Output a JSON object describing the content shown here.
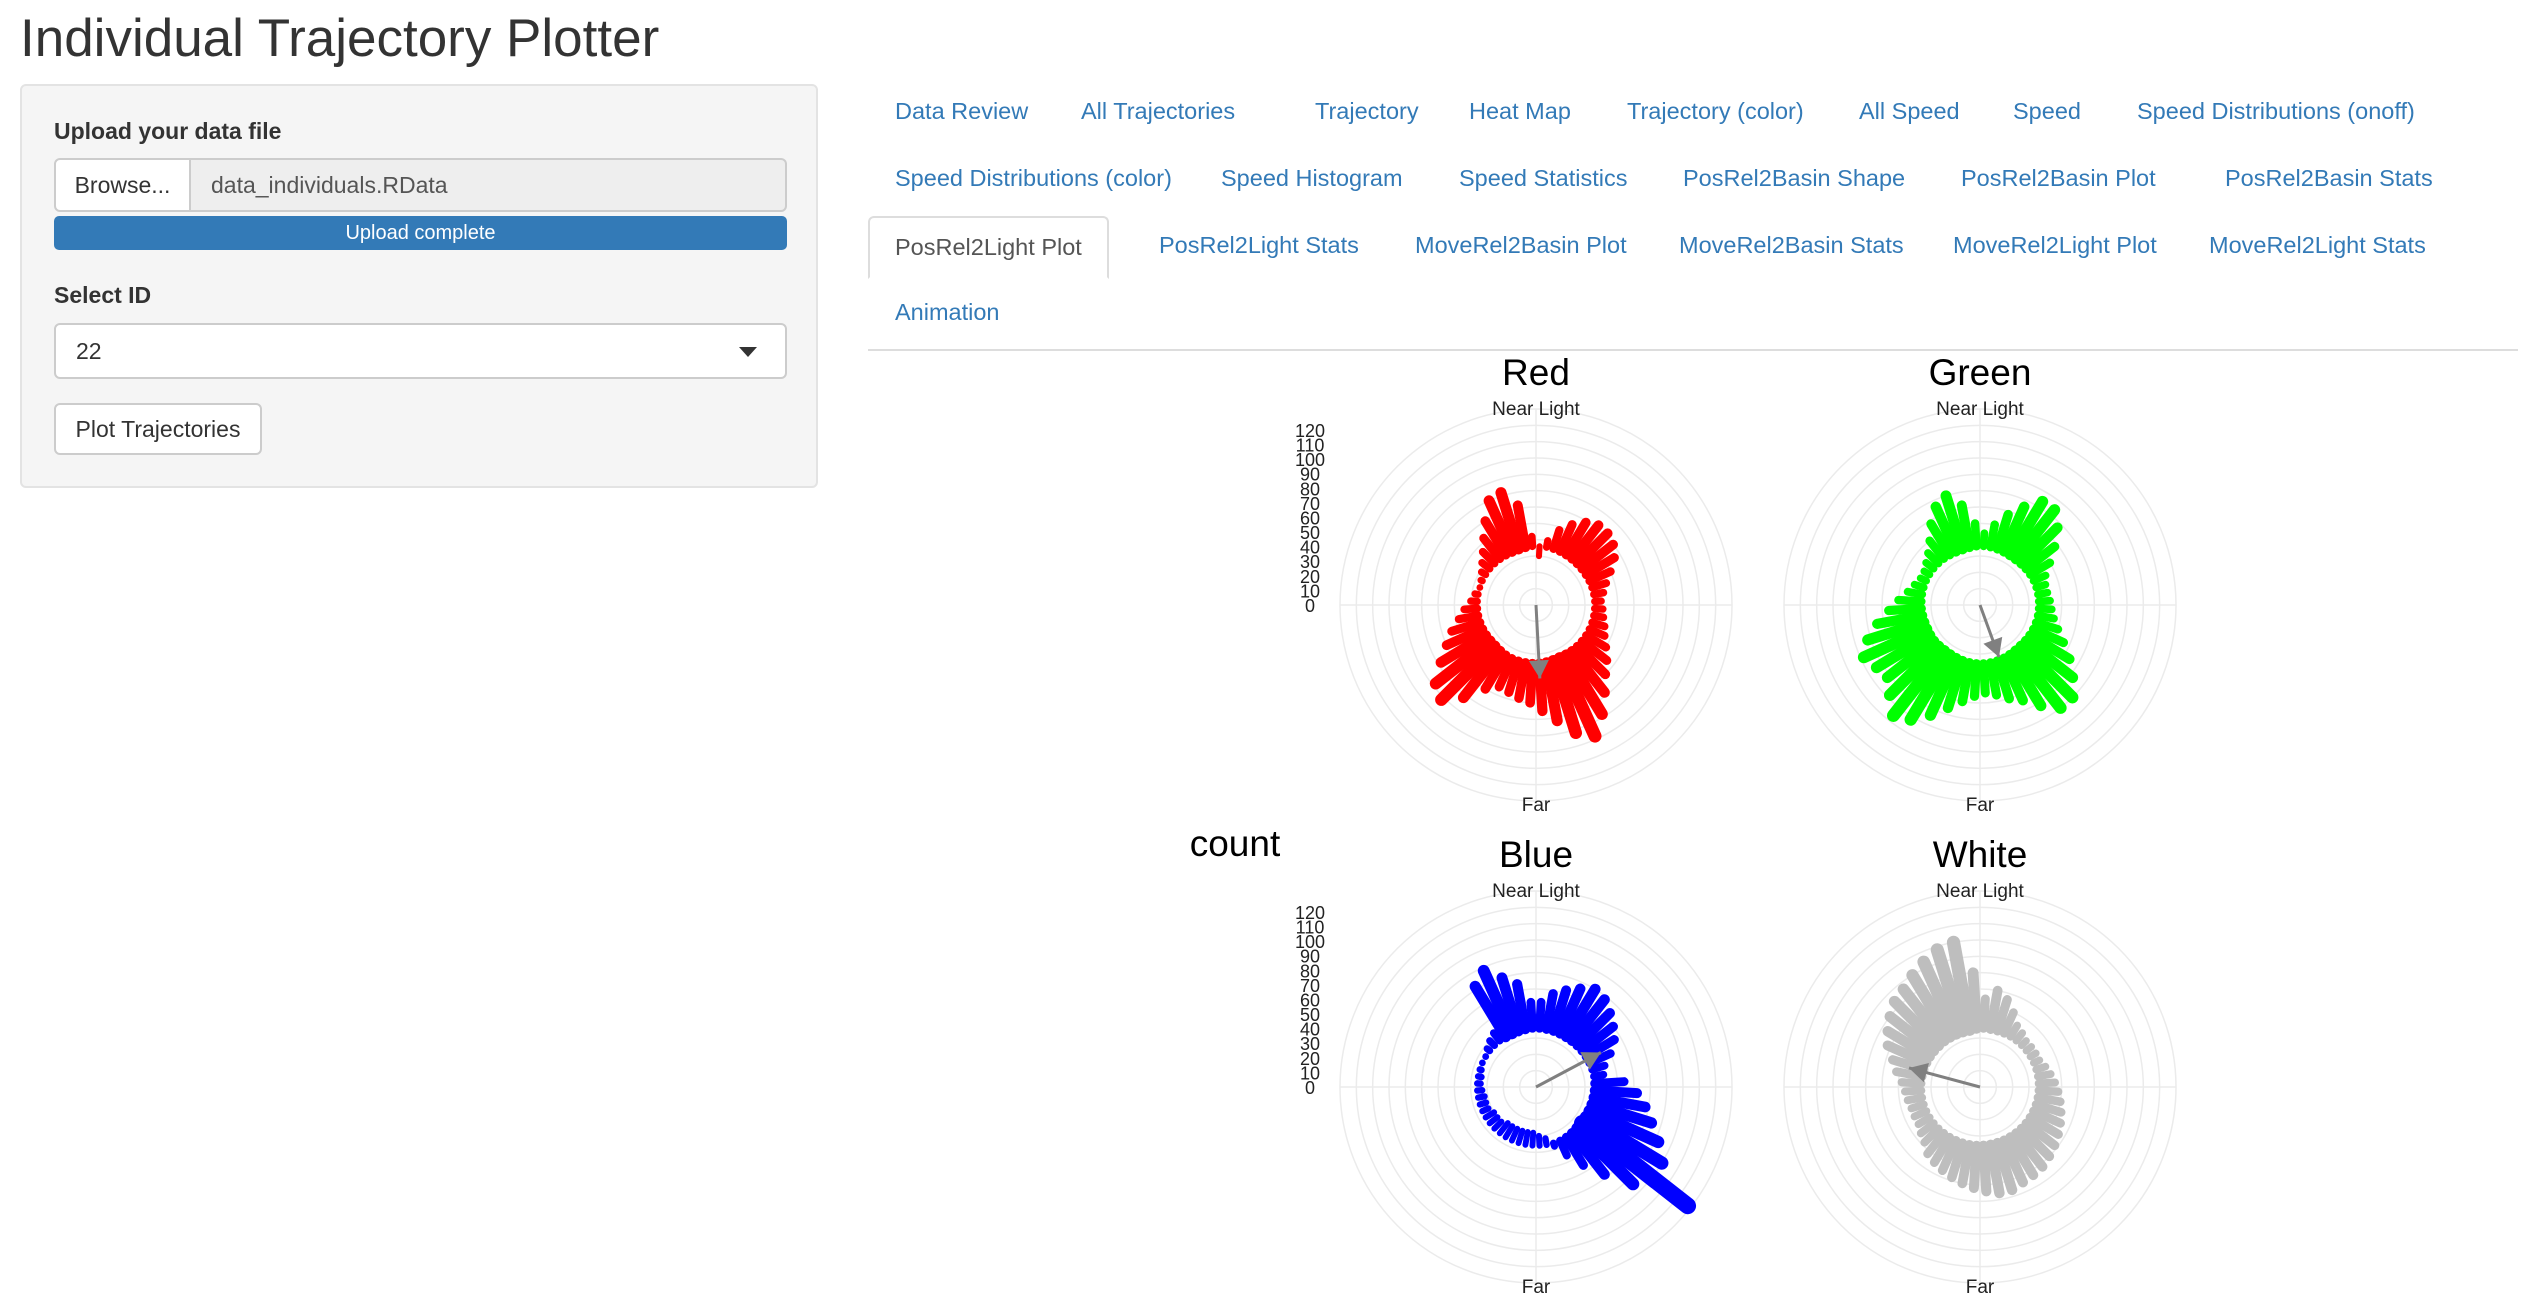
{
  "app": {
    "title": "Individual Trajectory Plotter"
  },
  "sidebar": {
    "upload_label": "Upload your data file",
    "browse_label": "Browse...",
    "file_name": "data_individuals.RData",
    "upload_status": "Upload complete",
    "select_label": "Select ID",
    "selected_id": "22",
    "plot_button": "Plot Trajectories"
  },
  "tabs": [
    {
      "label": "Data Review",
      "active": false
    },
    {
      "label": "All Trajectories",
      "active": false
    },
    {
      "label": "Trajectory",
      "active": false
    },
    {
      "label": "Heat Map",
      "active": false
    },
    {
      "label": "Trajectory (color)",
      "active": false
    },
    {
      "label": "All Speed",
      "active": false
    },
    {
      "label": "Speed",
      "active": false
    },
    {
      "label": "Speed Distributions (onoff)",
      "active": false
    },
    {
      "label": "Speed Distributions (color)",
      "active": false
    },
    {
      "label": "Speed Histogram",
      "active": false
    },
    {
      "label": "Speed Statistics",
      "active": false
    },
    {
      "label": "PosRel2Basin Shape",
      "active": false
    },
    {
      "label": "PosRel2Basin Plot",
      "active": false
    },
    {
      "label": "PosRel2Basin Stats",
      "active": false
    },
    {
      "label": "PosRel2Light Plot",
      "active": true
    },
    {
      "label": "PosRel2Light Stats",
      "active": false
    },
    {
      "label": "MoveRel2Basin Plot",
      "active": false
    },
    {
      "label": "MoveRel2Basin Stats",
      "active": false
    },
    {
      "label": "MoveRel2Light Plot",
      "active": false
    },
    {
      "label": "MoveRel2Light Stats",
      "active": false
    },
    {
      "label": "Animation",
      "active": false
    }
  ],
  "chart_data": {
    "type": "bar",
    "polar": true,
    "ylabel": "count",
    "rticks": [
      0,
      10,
      20,
      30,
      40,
      50,
      60,
      70,
      80,
      90,
      100,
      110,
      120
    ],
    "rlim": [
      0,
      120
    ],
    "top_label": "Near Light",
    "bottom_label": "Far",
    "arrow_color": "#808080",
    "panels": [
      {
        "title": "Red",
        "color": "#ff0000",
        "values": [
          30,
          40,
          48,
          54,
          59,
          62,
          62,
          60,
          56,
          50,
          45,
          42,
          40,
          41,
          42,
          44,
          46,
          50,
          55,
          60,
          68,
          78,
          88,
          82,
          72,
          65,
          60,
          58,
          56,
          55,
          60,
          72,
          82,
          78,
          68,
          60,
          54,
          48,
          44,
          40,
          38,
          36,
          37,
          39,
          42,
          46,
          52,
          60,
          70,
          72,
          62,
          42
        ],
        "arrow": {
          "angle_deg": 177,
          "length": 45
        }
      },
      {
        "title": "Green",
        "color": "#00ff00",
        "values": [
          44,
          50,
          58,
          66,
          74,
          74,
          67,
          58,
          50,
          44,
          42,
          42,
          43,
          44,
          46,
          50,
          56,
          64,
          72,
          80,
          80,
          72,
          64,
          60,
          56,
          54,
          56,
          60,
          66,
          74,
          82,
          86,
          78,
          72,
          74,
          78,
          72,
          64,
          56,
          50,
          45,
          42,
          40,
          40,
          42,
          45,
          50,
          58,
          66,
          70,
          62,
          50
        ],
        "arrow": {
          "angle_deg": 160,
          "length": 34
        }
      },
      {
        "title": "Blue",
        "color": "#0000ff",
        "values": [
          52,
          58,
          62,
          66,
          70,
          68,
          64,
          60,
          56,
          50,
          44,
          42,
          54,
          62,
          68,
          74,
          82,
          90,
          118,
          84,
          68,
          56,
          46,
          38,
          32,
          30,
          28,
          28,
          28,
          28,
          28,
          28,
          30,
          30,
          30,
          32,
          32,
          32,
          33,
          34,
          34,
          35,
          36,
          36,
          38,
          40,
          42,
          72,
          78,
          70,
          64,
          52
        ],
        "arrow": {
          "angle_deg": 62,
          "length": 45
        }
      },
      {
        "title": "White",
        "color": "#bebebe",
        "values": [
          54,
          60,
          56,
          50,
          44,
          42,
          40,
          40,
          40,
          40,
          42,
          44,
          46,
          48,
          50,
          52,
          54,
          56,
          58,
          60,
          62,
          63,
          64,
          66,
          66,
          64,
          62,
          60,
          58,
          56,
          54,
          52,
          48,
          46,
          44,
          44,
          44,
          45,
          46,
          48,
          52,
          56,
          62,
          66,
          70,
          74,
          76,
          80,
          84,
          88,
          90,
          70
        ],
        "arrow": {
          "angle_deg": 285,
          "length": 45
        }
      }
    ]
  }
}
